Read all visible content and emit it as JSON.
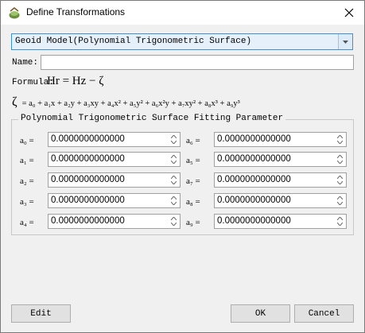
{
  "window": {
    "title": "Define Transformations"
  },
  "model_select": {
    "value": "Geoid Model(Polynomial Trigonometric Surface)"
  },
  "name": {
    "label": "Name:",
    "value": ""
  },
  "formula": {
    "label": "Formula:",
    "expression": "Hr = Hz − ζ",
    "zeta": "ζ",
    "polynomial": "= a₀ + a₁x + a₂y + a₃xy + a₄x² + a₅y² + a₆x²y + a₇xy² + a₈x³ + a₉y³"
  },
  "parameters": {
    "group_title": "Polynomial Trigonometric Surface Fitting Parameter",
    "left": [
      {
        "label": "a₀ =",
        "value": "0.0000000000000"
      },
      {
        "label": "a₁ =",
        "value": "0.0000000000000"
      },
      {
        "label": "a₂ =",
        "value": "0.0000000000000"
      },
      {
        "label": "a₃ =",
        "value": "0.0000000000000"
      },
      {
        "label": "a₄ =",
        "value": "0.0000000000000"
      }
    ],
    "right": [
      {
        "label": "a₆ =",
        "value": "0.0000000000000"
      },
      {
        "label": "a₅ =",
        "value": "0.0000000000000"
      },
      {
        "label": "a₇ =",
        "value": "0.0000000000000"
      },
      {
        "label": "a₈ =",
        "value": "0.0000000000000"
      },
      {
        "label": "a₉ =",
        "value": "0.0000000000000"
      }
    ]
  },
  "buttons": {
    "edit": "Edit",
    "ok": "OK",
    "cancel": "Cancel"
  }
}
